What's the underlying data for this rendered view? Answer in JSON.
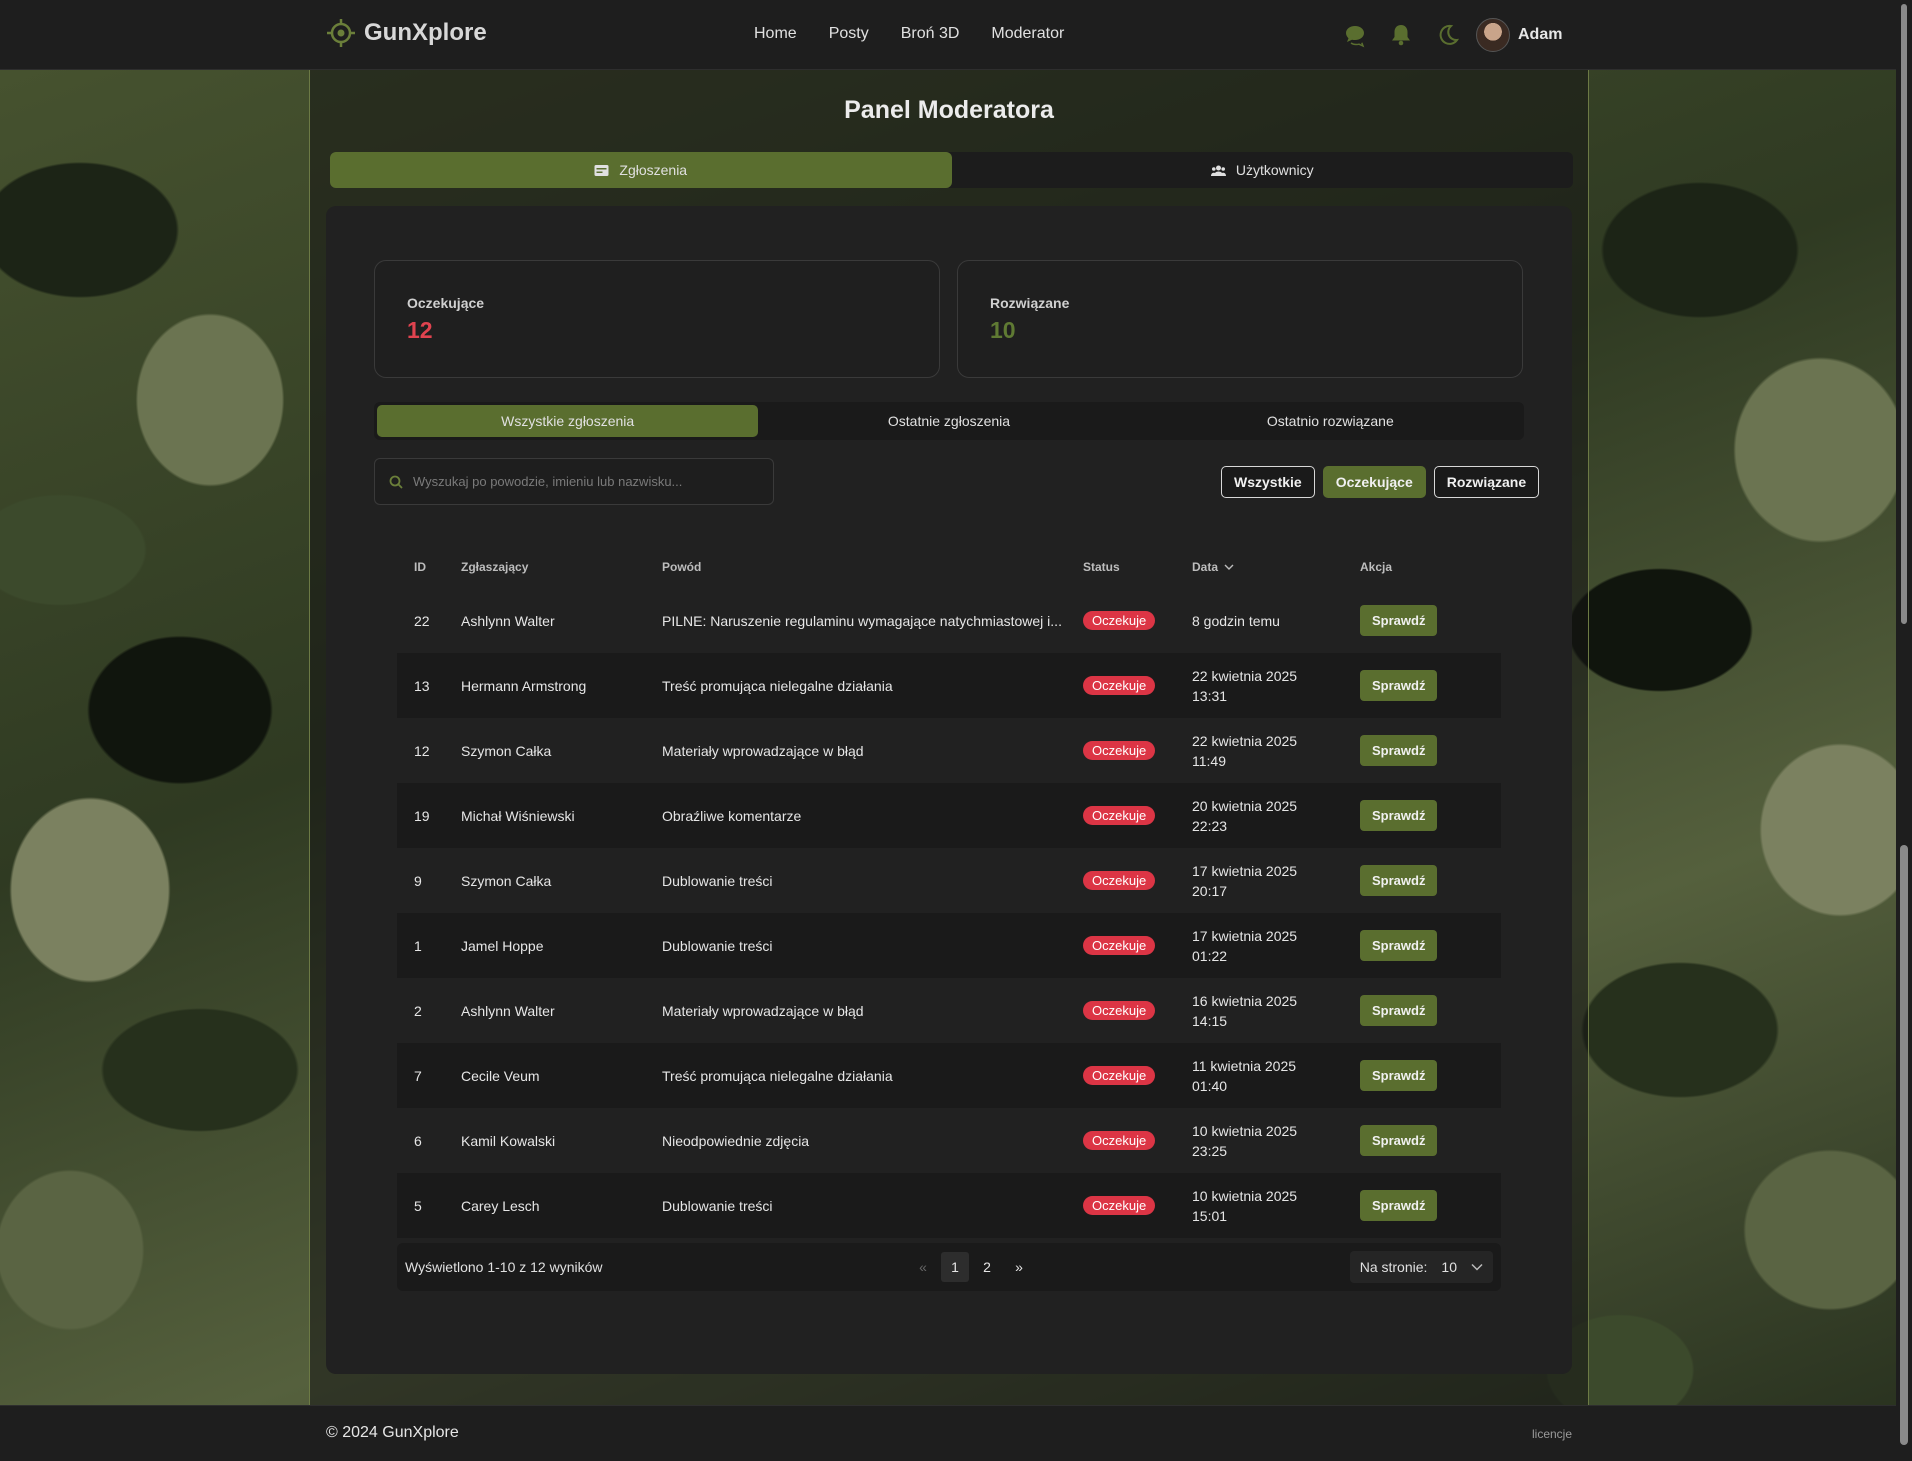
{
  "header": {
    "brand": "GunXplore",
    "nav": [
      "Home",
      "Posty",
      "Broń 3D",
      "Moderator"
    ],
    "user_name": "Adam"
  },
  "page": {
    "title": "Panel Moderatora",
    "tabs": [
      "Zgłoszenia",
      "Użytkownicy"
    ]
  },
  "stats": {
    "pending_label": "Oczekujące",
    "pending_value": "12",
    "resolved_label": "Rozwiązane",
    "resolved_value": "10"
  },
  "subtabs": [
    "Wszystkie zgłoszenia",
    "Ostatnie zgłoszenia",
    "Ostatnio rozwiązane"
  ],
  "search": {
    "placeholder": "Wyszukaj po powodzie, imieniu lub nazwisku..."
  },
  "filters": [
    "Wszystkie",
    "Oczekujące",
    "Rozwiązane"
  ],
  "table": {
    "headers": [
      "ID",
      "Zgłaszający",
      "Powód",
      "Status",
      "Data",
      "Akcja"
    ],
    "rows": [
      {
        "id": "22",
        "reporter": "Ashlynn Walter",
        "reason": "PILNE: Naruszenie regulaminu wymagające natychmiastowej i...",
        "status": "Oczekuje",
        "date1": "8 godzin temu",
        "date2": "",
        "action": "Sprawdź"
      },
      {
        "id": "13",
        "reporter": "Hermann Armstrong",
        "reason": "Treść promująca nielegalne działania",
        "status": "Oczekuje",
        "date1": "22 kwietnia 2025",
        "date2": "13:31",
        "action": "Sprawdź"
      },
      {
        "id": "12",
        "reporter": "Szymon Całka",
        "reason": "Materiały wprowadzające w błąd",
        "status": "Oczekuje",
        "date1": "22 kwietnia 2025",
        "date2": "11:49",
        "action": "Sprawdź"
      },
      {
        "id": "19",
        "reporter": "Michał Wiśniewski",
        "reason": "Obraźliwe komentarze",
        "status": "Oczekuje",
        "date1": "20 kwietnia 2025",
        "date2": "22:23",
        "action": "Sprawdź"
      },
      {
        "id": "9",
        "reporter": "Szymon Całka",
        "reason": "Dublowanie treści",
        "status": "Oczekuje",
        "date1": "17 kwietnia 2025",
        "date2": "20:17",
        "action": "Sprawdź"
      },
      {
        "id": "1",
        "reporter": "Jamel Hoppe",
        "reason": "Dublowanie treści",
        "status": "Oczekuje",
        "date1": "17 kwietnia 2025",
        "date2": "01:22",
        "action": "Sprawdź"
      },
      {
        "id": "2",
        "reporter": "Ashlynn Walter",
        "reason": "Materiały wprowadzające w błąd",
        "status": "Oczekuje",
        "date1": "16 kwietnia 2025",
        "date2": "14:15",
        "action": "Sprawdź"
      },
      {
        "id": "7",
        "reporter": "Cecile Veum",
        "reason": "Treść promująca nielegalne działania",
        "status": "Oczekuje",
        "date1": "11 kwietnia 2025",
        "date2": "01:40",
        "action": "Sprawdź"
      },
      {
        "id": "6",
        "reporter": "Kamil Kowalski",
        "reason": "Nieodpowiednie zdjęcia",
        "status": "Oczekuje",
        "date1": "10 kwietnia 2025",
        "date2": "23:25",
        "action": "Sprawdź"
      },
      {
        "id": "5",
        "reporter": "Carey Lesch",
        "reason": "Dublowanie treści",
        "status": "Oczekuje",
        "date1": "10 kwietnia 2025",
        "date2": "15:01",
        "action": "Sprawdź"
      }
    ]
  },
  "pagination": {
    "info": "Wyświetlono 1-10 z 12 wyników",
    "prev": "«",
    "pages": [
      "1",
      "2"
    ],
    "next": "»",
    "per_page_label": "Na stronie:",
    "per_page_value": "10"
  },
  "footer": {
    "copyright": "© 2024 GunXplore",
    "license": "licencje"
  },
  "colors": {
    "accent": "#5a6e2f",
    "danger": "#dc3545",
    "background": "#1e1e1e"
  }
}
